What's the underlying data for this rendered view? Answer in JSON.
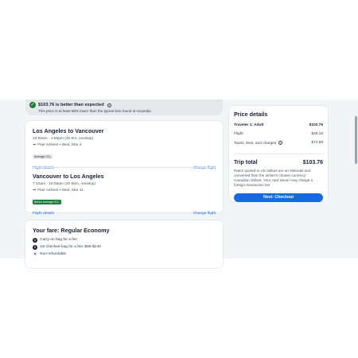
{
  "banner": {
    "title": "$103.76 is better than expected",
    "info_icon": "info-icon",
    "subtitle": "This price is at least 68% lower than the typical fare found on Expedia"
  },
  "flights": [
    {
      "route": "Los Angeles to Vancouver",
      "time": "10:50am - 1:55pm (3h 5m, nonstop)",
      "airline": "Flair Airlines • Wed, Mar 4",
      "co2": "Average CO₂",
      "details_link": "Flight details",
      "change_link": "Change flight"
    },
    {
      "route": "Vancouver to Los Angeles",
      "time": "7:10am - 10:05am (2h 55m, nonstop)",
      "airline": "Flair Airlines • Wed, Mar 11",
      "co2": "Below average CO₂",
      "details_link": "Flight details",
      "change_link": "Change flight"
    }
  ],
  "fare": {
    "title": "Your fare: Regular Economy",
    "items": [
      {
        "icon": "carry-on-bag-icon",
        "text": "Carry-on bag for a fee"
      },
      {
        "icon": "checked-bag-icon",
        "text": "1st checked bag for a fee: $58-$240"
      },
      {
        "icon": "close-icon",
        "text": "Non-refundable"
      }
    ]
  },
  "price": {
    "heading": "Price details",
    "traveler_label": "Traveler 1: Adult",
    "traveler_value": "$103.76",
    "flight_label": "Flight",
    "flight_value": "$29.18",
    "taxes_label": "Taxes, fees, and charges",
    "taxes_value": "$74.58",
    "total_label": "Trip total",
    "total_value": "$103.76",
    "note": "Rates quoted in US dollars are an estimate and converted from the airline's chosen currency: Canadian dollars. Your card issuer may charge a foreign transaction fee.",
    "checkout_label": "Next: Checkout"
  },
  "colors": {
    "accent": "#1668e3",
    "success": "#1e7d3a",
    "text": "#1a1f36",
    "page_background": "#f3f4f6"
  }
}
